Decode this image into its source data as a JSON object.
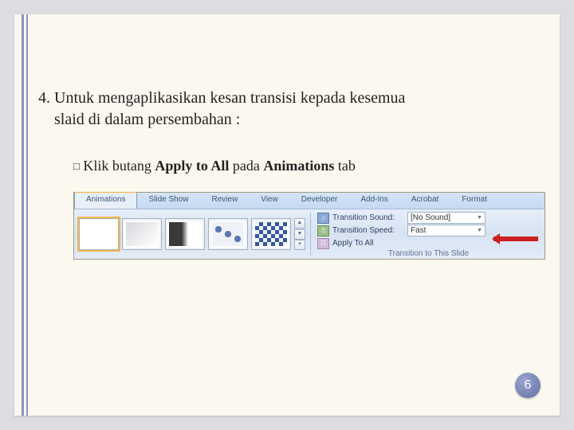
{
  "main": {
    "line1": "4. Untuk mengaplikasikan kesan transisi kepada kesemua",
    "line2": "slaid di dalam persembahan :"
  },
  "bullet": {
    "pre": "Klik butang ",
    "bold1": "Apply to All",
    "mid": " pada ",
    "bold2": "Animations",
    "post": " tab"
  },
  "ribbon": {
    "tabs": {
      "animations": "Animations",
      "slideshow": "Slide Show",
      "review": "Review",
      "view": "View",
      "developer": "Developer",
      "addins": "Add-Ins",
      "acrobat": "Acrobat",
      "format": "Format"
    },
    "options": {
      "sound_label": "Transition Sound:",
      "sound_value": "[No Sound]",
      "speed_label": "Transition Speed:",
      "speed_value": "Fast",
      "apply_all": "Apply To All"
    },
    "group_caption": "Transition to This Slide"
  },
  "page_number": "6"
}
